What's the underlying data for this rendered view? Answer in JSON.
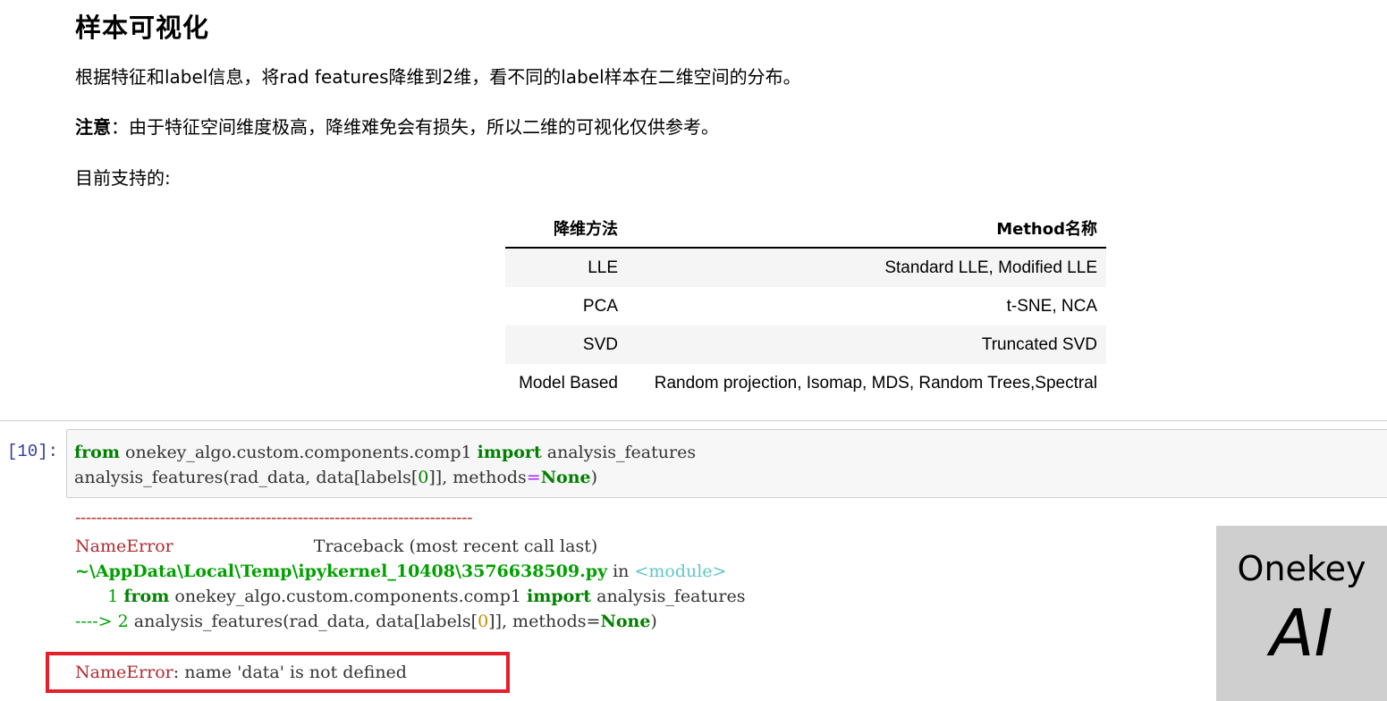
{
  "markdown": {
    "heading": "样本可视化",
    "para1": "根据特征和label信息，将rad features降维到2维，看不同的label样本在二维空间的分布。",
    "note_label": "注意",
    "note_text": "：由于特征空间维度极高，降维难免会有损失，所以二维的可视化仅供参考。",
    "para3": "目前支持的:"
  },
  "table": {
    "headers": [
      "降维方法",
      "Method名称"
    ],
    "rows": [
      [
        "LLE",
        "Standard LLE, Modified LLE"
      ],
      [
        "PCA",
        "t-SNE, NCA"
      ],
      [
        "SVD",
        "Truncated SVD"
      ],
      [
        "Model Based",
        "Random projection, Isomap, MDS, Random Trees,Spectral"
      ]
    ]
  },
  "cell": {
    "prompt": "[10]:",
    "line1": {
      "kw1": "from",
      "mod": " onekey_algo.custom.components.comp1 ",
      "kw2": "import",
      "name": " analysis_features"
    },
    "line2": {
      "pre": "analysis_features(rad_data, data[labels[",
      "num": "0",
      "mid": "]], methods",
      "op": "=",
      "none": "None",
      "post": ")"
    }
  },
  "output": {
    "dashes": "---------------------------------------------------------------------------",
    "err_name": "NameError",
    "traceback_label": "                          Traceback (most recent call last)",
    "file_path": "~\\AppData\\Local\\Temp\\ipykernel_10408\\3576638509.py",
    "in_text": " in ",
    "module": "<module>",
    "tb_line1_num": "      1 ",
    "tb_line1_kw1": "from",
    "tb_line1_mod": " onekey_algo.custom.components.comp1 ",
    "tb_line1_kw2": "import",
    "tb_line1_name": " analysis_features",
    "tb_arrow": "----> 2 ",
    "tb_line2_pre": "analysis_features(rad_data, data[labels[",
    "tb_line2_num": "0",
    "tb_line2_mid": "]], methods=",
    "tb_line2_none": "None",
    "tb_line2_post": ")",
    "final_err_name": "NameError",
    "final_err_msg": ": name 'data' is not defined"
  },
  "logo": {
    "line1": "Onekey",
    "line2": "AI"
  },
  "colors": {
    "error_box": "#e5202b",
    "keyword": "#008000",
    "error_text": "#b22b31",
    "prompt": "#303f9f"
  }
}
